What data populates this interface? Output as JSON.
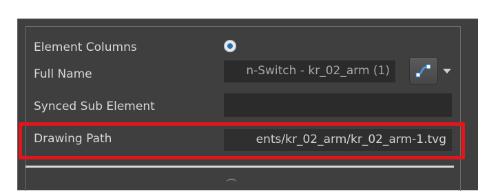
{
  "rows": {
    "element_columns": {
      "label": "Element Columns",
      "selected": true
    },
    "full_name": {
      "label": "Full Name",
      "value": "n-Switch - kr_02_arm (1)"
    },
    "synced_sub_element": {
      "label": "Synced Sub Element",
      "value": ""
    },
    "drawing_path": {
      "label": "Drawing Path",
      "value": "ents/kr_02_arm/kr_02_arm-1.tvg"
    }
  },
  "icons": {
    "link_button": "curve-link-icon",
    "dropdown": "chevron-down-icon",
    "radio": "radio-selected-icon"
  },
  "colors": {
    "panel_bg": "#3f3f3f",
    "field_bg": "#2b2b2b",
    "label_text": "#d8d8d8",
    "field_text": "#a8a8a8",
    "highlight": "#e3151a",
    "radio_dot": "#2a6db5"
  }
}
